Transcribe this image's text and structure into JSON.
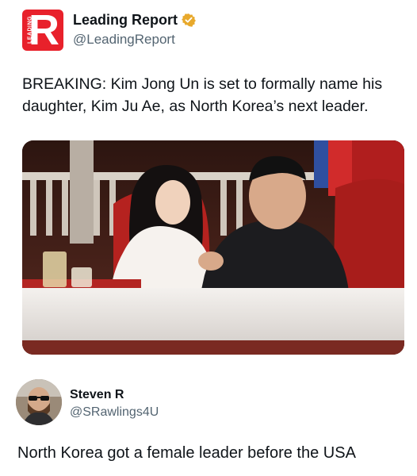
{
  "tweet": {
    "author": {
      "display_name": "Leading Report",
      "handle": "@LeadingReport",
      "avatar_letter": "R",
      "avatar_side_text": "LEADING",
      "avatar_icon": "leading-report-logo",
      "verified_icon": "verified-badge-icon",
      "brand_color": "#e8212b",
      "badge_color": "#e8a92c"
    },
    "text": "BREAKING: Kim Jong Un is set to formally name his daughter, Kim Ju Ae, as North Korea’s next leader.",
    "image": "photo of Kim Jong Un and his daughter seated in red chairs"
  },
  "reply": {
    "author": {
      "display_name": "Steven R",
      "handle": "@SRawlings4U",
      "avatar_icon": "user-avatar"
    },
    "text": "North Korea got a female leader before the USA"
  }
}
